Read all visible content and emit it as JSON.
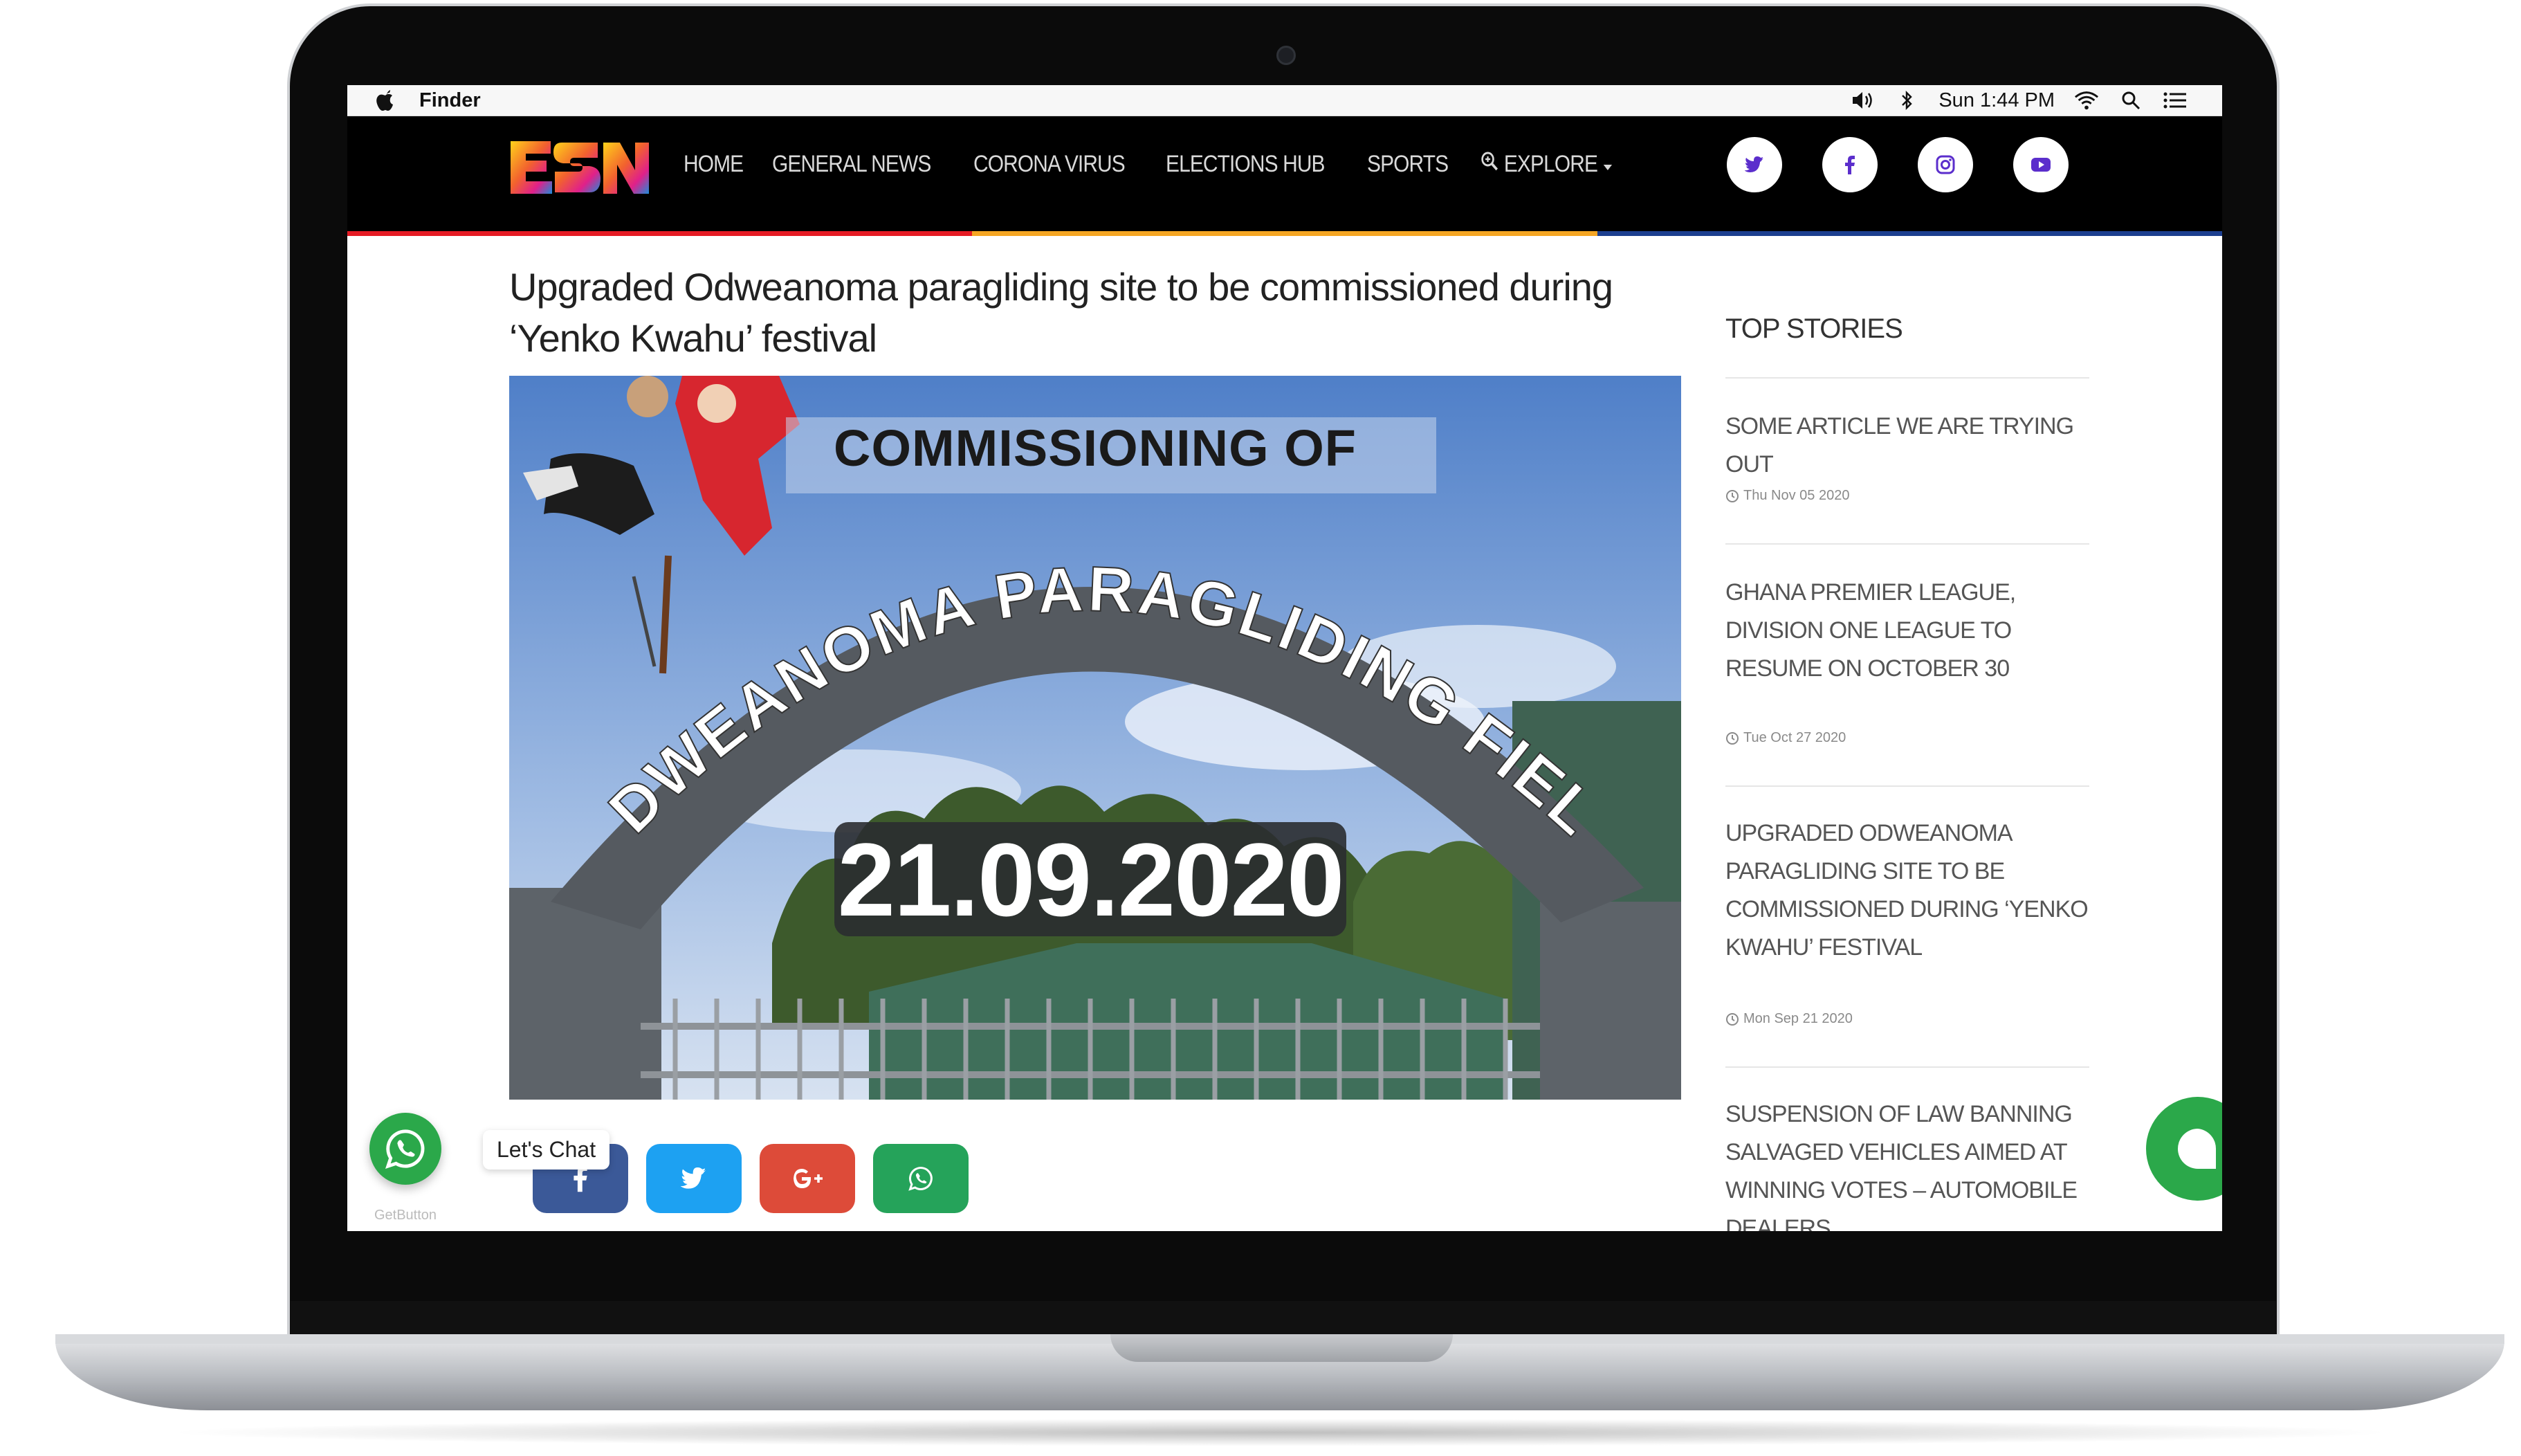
{
  "menubar": {
    "app_name": "Finder",
    "clock": "Sun 1:44 PM",
    "icons": [
      "apple-icon",
      "volume-icon",
      "bluetooth-icon",
      "wifi-icon",
      "spotlight-search-icon",
      "notification-center-icon"
    ]
  },
  "site": {
    "logo_text": "ESN",
    "nav": {
      "home": "HOME",
      "general_news": "GENERAL NEWS",
      "corona_virus": "CORONA VIRUS",
      "elections_hub": "ELECTIONS HUB",
      "sports": "SPORTS",
      "explore": "EXPLORE"
    },
    "social_icons": [
      "twitter-icon",
      "facebook-icon",
      "instagram-icon",
      "youtube-icon"
    ],
    "stripe_colors": [
      "#e51b24",
      "#f5a623",
      "#1c3f8f"
    ]
  },
  "article": {
    "headline": "Upgraded Odweanoma paragliding site to be commissioned during ‘Yenko Kwahu’ festival",
    "image": {
      "top_text": "COMMISSIONING OF",
      "arch_text": "ODWEANOMA PARAGLIDING FIELD",
      "date_text": "21.09.2020"
    },
    "share_buttons": [
      {
        "name": "facebook",
        "color": "#3b5998"
      },
      {
        "name": "twitter",
        "color": "#1da1f2"
      },
      {
        "name": "google-plus",
        "color": "#dd4b39"
      },
      {
        "name": "whatsapp",
        "color": "#25a35a"
      }
    ]
  },
  "sidebar": {
    "title": "TOP STORIES",
    "stories": [
      {
        "title": "SOME ARTICLE WE ARE TRYING OUT",
        "date": "Thu Nov 05 2020"
      },
      {
        "title": "GHANA PREMIER LEAGUE, DIVISION ONE LEAGUE TO RESUME ON OCTOBER 30",
        "date": "Tue Oct 27 2020"
      },
      {
        "title": "UPGRADED ODWEANOMA PARAGLIDING SITE TO BE COMMISSIONED DURING ‘YENKO KWAHU’ FESTIVAL",
        "date": "Mon Sep 21 2020"
      },
      {
        "title": "SUSPENSION OF LAW BANNING SALVAGED VEHICLES AIMED AT WINNING VOTES – AUTOMOBILE DEALERS",
        "date": ""
      }
    ]
  },
  "widgets": {
    "whatsapp_label": "Let's Chat",
    "getbutton_text": "GetButton",
    "whatsapp_color": "#2ba84a"
  }
}
